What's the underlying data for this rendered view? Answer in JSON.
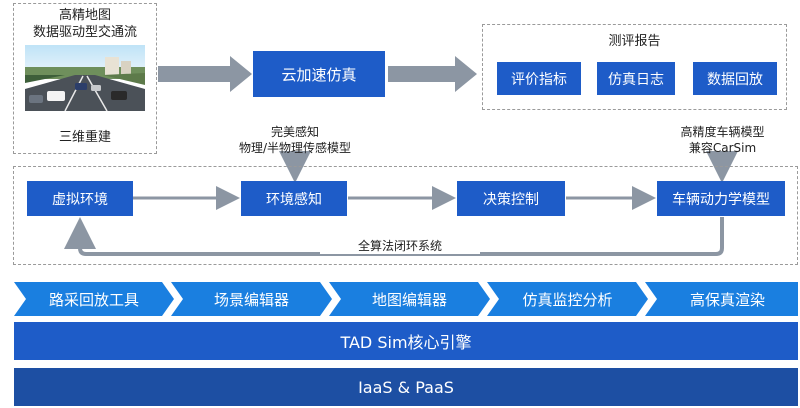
{
  "hd_map": {
    "title_line1": "高精地图",
    "title_line2": "数据驱动型交通流",
    "caption": "三维重建"
  },
  "cloud_sim": "云加速仿真",
  "report": {
    "title": "测评报告",
    "items": [
      "评价指标",
      "仿真日志",
      "数据回放"
    ]
  },
  "perception_note": {
    "line1": "完美感知",
    "line2": "物理/半物理传感模型"
  },
  "vehicle_note": {
    "line1": "高精度车辆模型",
    "line2": "兼容CarSim"
  },
  "loop": {
    "nodes": [
      "虚拟环境",
      "环境感知",
      "决策控制",
      "车辆动力学模型"
    ],
    "caption": "全算法闭环系统"
  },
  "tools": [
    "路采回放工具",
    "场景编辑器",
    "地图编辑器",
    "仿真监控分析",
    "高保真渲染"
  ],
  "engine": "TAD Sim核心引擎",
  "platform": "IaaS & PaaS",
  "colors": {
    "primary_blue": "#1e5cc8",
    "chevron_blue": "#1a7fe0",
    "platform_blue": "#1d4fa3",
    "arrow_gray": "#8c96a3"
  }
}
